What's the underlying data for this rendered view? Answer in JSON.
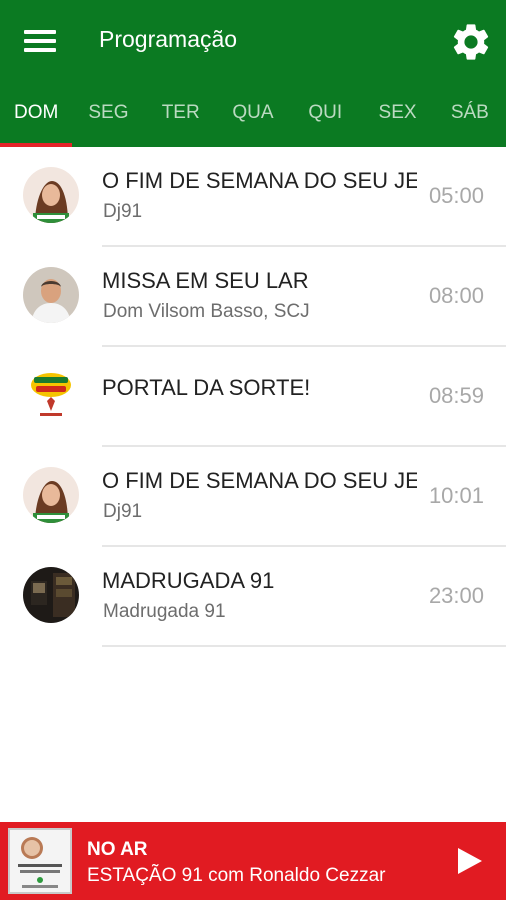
{
  "header": {
    "title": "Programação",
    "menu_icon": "hamburger-menu-icon",
    "settings_icon": "gear-icon",
    "background": "#0b7a22"
  },
  "tabs": [
    {
      "label": "DOM",
      "active": true
    },
    {
      "label": "SEG",
      "active": false
    },
    {
      "label": "TER",
      "active": false
    },
    {
      "label": "QUA",
      "active": false
    },
    {
      "label": "QUI",
      "active": false
    },
    {
      "label": "SEX",
      "active": false
    },
    {
      "label": "SÁB",
      "active": false
    }
  ],
  "accent": "#e52329",
  "schedule": [
    {
      "title": "O FIM DE SEMANA DO SEU JEITO",
      "subtitle": "Dj91",
      "time": "05:00"
    },
    {
      "title": "MISSA EM SEU LAR",
      "subtitle": "Dom Vilsom Basso, SCJ",
      "time": "08:00"
    },
    {
      "title": "PORTAL DA SORTE!",
      "subtitle": "",
      "time": "08:59"
    },
    {
      "title": "O FIM DE SEMANA DO SEU JEITO",
      "subtitle": "Dj91",
      "time": "10:01"
    },
    {
      "title": "MADRUGADA 91",
      "subtitle": "Madrugada 91",
      "time": "23:00"
    }
  ],
  "player": {
    "label": "NO AR",
    "now_playing": "ESTAÇÃO 91 com Ronaldo Cezzar",
    "play_icon": "play-icon",
    "background": "#e11b22"
  }
}
